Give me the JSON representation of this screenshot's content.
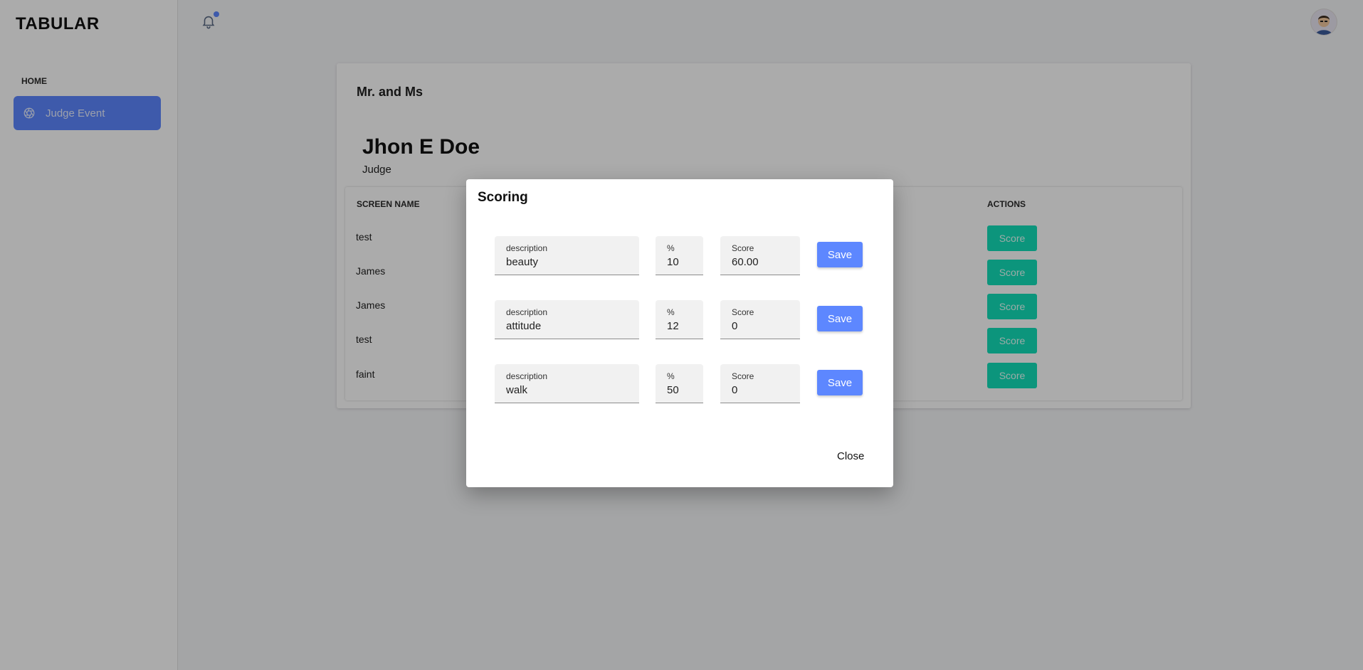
{
  "app": {
    "brand": "TABULAR"
  },
  "sidebar": {
    "heading": "HOME",
    "items": [
      {
        "label": "Judge Event",
        "icon": "aperture-icon"
      }
    ]
  },
  "header": {
    "notifications_icon": "bell-icon",
    "has_unread": true
  },
  "card": {
    "title": "Mr. and Ms",
    "judge": {
      "name": "Jhon E Doe",
      "role": "Judge"
    },
    "table": {
      "columns": [
        "SCREEN NAME",
        "ACTIONS"
      ],
      "rows": [
        {
          "screen_name": "test",
          "action": "Score"
        },
        {
          "screen_name": "James",
          "action": "Score"
        },
        {
          "screen_name": "James",
          "action": "Score"
        },
        {
          "screen_name": "test",
          "action": "Score"
        },
        {
          "screen_name": "faint",
          "action": "Score"
        }
      ]
    }
  },
  "modal": {
    "title": "Scoring",
    "criteria": [
      {
        "description_label": "description",
        "description": "beauty",
        "percent_label": "%",
        "percent": "10",
        "score_label": "Score",
        "score": "60.00",
        "save_label": "Save"
      },
      {
        "description_label": "description",
        "description": "attitude",
        "percent_label": "%",
        "percent": "12",
        "score_label": "Score",
        "score": "0",
        "save_label": "Save"
      },
      {
        "description_label": "description",
        "description": "walk",
        "percent_label": "%",
        "percent": "50",
        "score_label": "Score",
        "score": "0",
        "save_label": "Save"
      }
    ],
    "close_label": "Close"
  },
  "colors": {
    "primary": "#5d87ff",
    "score_button": "#13deb9"
  }
}
